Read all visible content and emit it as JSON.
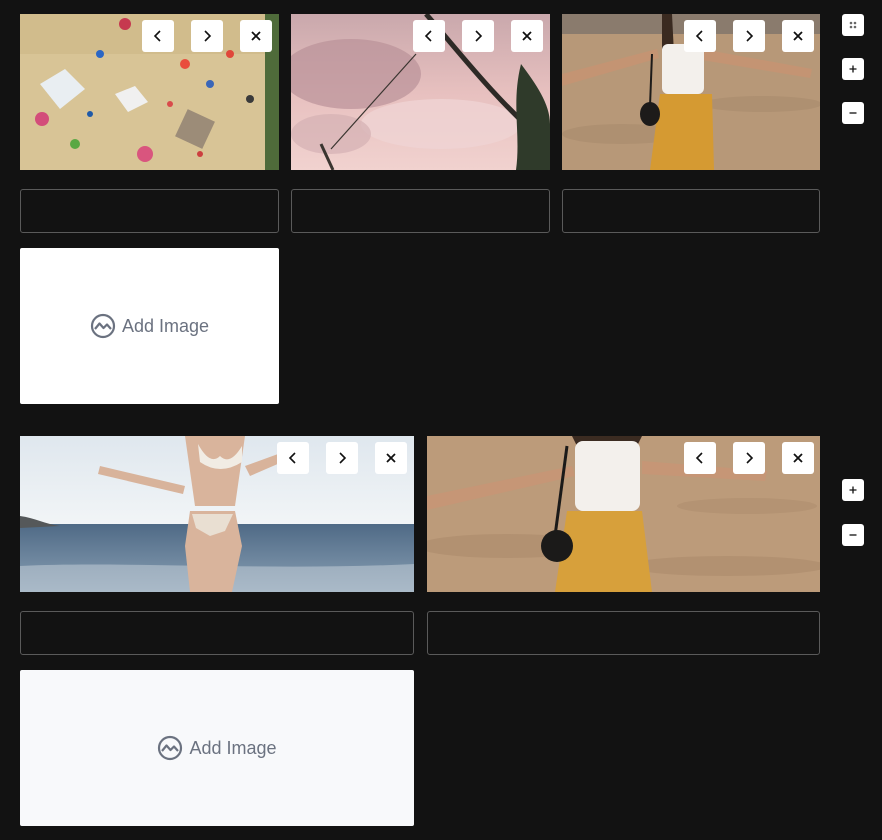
{
  "gallery1": {
    "images": [
      {
        "alt_icon": "aerial-beach-photo"
      },
      {
        "alt_icon": "pink-sky-palm-photo"
      },
      {
        "alt_icon": "woman-on-sand-photo"
      }
    ],
    "add_image_label": "Add Image"
  },
  "gallery2": {
    "images": [
      {
        "alt_icon": "woman-at-sea-photo"
      },
      {
        "alt_icon": "woman-on-sand-photo"
      }
    ],
    "add_image_label": "Add Image"
  },
  "icons": {
    "prev": "chevron-left-icon",
    "next": "chevron-right-icon",
    "remove": "close-icon",
    "drag": "drag-handle-icon",
    "add": "plus-icon",
    "minus": "minus-icon",
    "image": "image-icon"
  },
  "colors": {
    "background": "#121212",
    "card": "#ffffff",
    "caption_border": "#5a5a5a",
    "add_text": "#6b7280"
  }
}
